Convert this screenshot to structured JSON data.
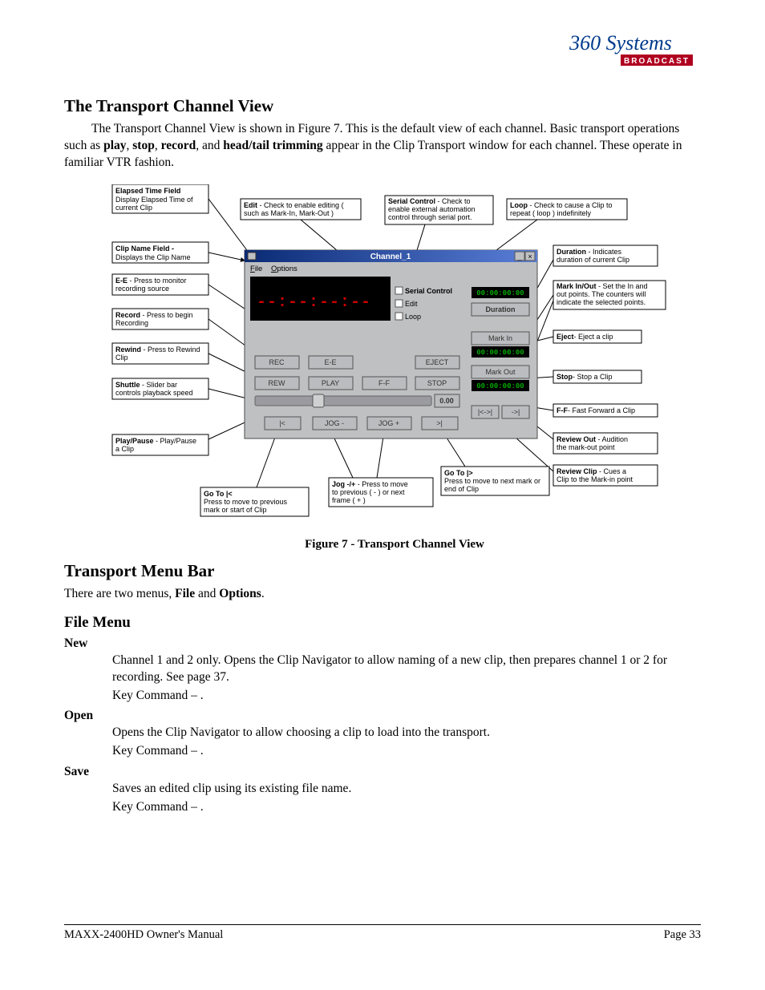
{
  "header": {
    "logo_top": "360 Systems",
    "logo_sub": "BROADCAST"
  },
  "section1": {
    "title": "The Transport Channel View",
    "para": "The Transport Channel View is shown in Figure 7.  This is the default view of each channel.  Basic transport operations such as ",
    "b1": "play",
    "b2": "stop",
    "b3": "record",
    "b4": "head/tail trimming",
    "para2": " appear in the Clip Transport window for each channel.  These operate in familiar VTR fashion."
  },
  "figure": {
    "caption": "Figure 7 - Transport Channel View",
    "window_title": "Channel_1",
    "menu_file": "File",
    "menu_options": "Options",
    "big_time": "--:--:--:--",
    "chk_serial": "Serial Control",
    "chk_edit": "Edit",
    "chk_loop": "Loop",
    "tc1": "00:00:00:00",
    "duration_label": "Duration",
    "mark_in_label": "Mark In",
    "mark_out_label": "Mark Out",
    "tc_markin": "00:00:00:00",
    "tc_markout": "00:00:00:00",
    "btn_rec": "REC",
    "btn_ee": "E-E",
    "btn_eject": "EJECT",
    "btn_rew": "REW",
    "btn_play": "PLAY",
    "btn_ff": "F-F",
    "btn_stop": "STOP",
    "btn_review_clip": "|<->|",
    "btn_review_out": "->|",
    "btn_goto_start": "|<",
    "btn_jogm": "JOG -",
    "btn_jogp": "JOG +",
    "btn_goto_end": ">|",
    "slider_val": "0.00",
    "callouts": {
      "elapsed_h": "Elapsed Time Field",
      "elapsed": "Display Elapsed Time of current Clip",
      "edit": "Edit - Check to enable editing ( such as Mark-In, Mark-Out )",
      "serial": "Serial Control - Check to enable external automation control through serial port.",
      "loop": "Loop - Check to cause a Clip to repeat ( loop ) indefinitely",
      "clipname": "Clip Name Field - Displays the Clip Name",
      "duration": "Duration - Indicates duration of current Clip",
      "ee": "E-E - Press to monitor recording source",
      "markio": "Mark In/Out - Set the In and out points. The counters will indicate the selected points.",
      "record": "Record - Press to begin Recording",
      "eject": "Eject- Eject a clip",
      "rewind": "Rewind - Press to Rewind Clip",
      "stop": "Stop- Stop a Clip",
      "shuttle": "Shuttle - Slider bar controls playback speed",
      "ff": "F-F- Fast Forward a Clip",
      "playpause": "Play/Pause - Play/Pause a Clip",
      "revout": "Review Out - Audition the mark-out point",
      "revclip": "Review Clip - Cues a Clip to the Mark-in point",
      "goto_start_h": "Go To |<",
      "goto_start": "Press to move to previous mark or start of Clip",
      "jog": "Jog -/+ - Press to move to previous ( - ) or next frame ( + )",
      "goto_end_h": "Go To |>",
      "goto_end": "Press to move to next mark or end of Clip"
    }
  },
  "section2": {
    "title": "Transport Menu Bar",
    "para": "There are two menus, ",
    "b1": "File",
    "and": " and ",
    "b2": "Options",
    "end": "."
  },
  "section3": {
    "title": "File Menu",
    "items": [
      {
        "h": "New",
        "lines": [
          "Channel 1 and 2 only.  Opens the Clip Navigator to allow naming of a new clip, then prepares channel 1 or 2 for recording. See page 37.",
          "Key Command –              ."
        ]
      },
      {
        "h": "Open",
        "lines": [
          "Opens the Clip Navigator to allow choosing a clip to load into the transport.",
          "Key Command –              ."
        ]
      },
      {
        "h": "Save",
        "lines": [
          "Saves an edited clip using its existing file name.",
          "Key Command –              ."
        ]
      }
    ]
  },
  "footer": {
    "left": "MAXX-2400HD Owner's Manual",
    "right": "Page 33"
  }
}
